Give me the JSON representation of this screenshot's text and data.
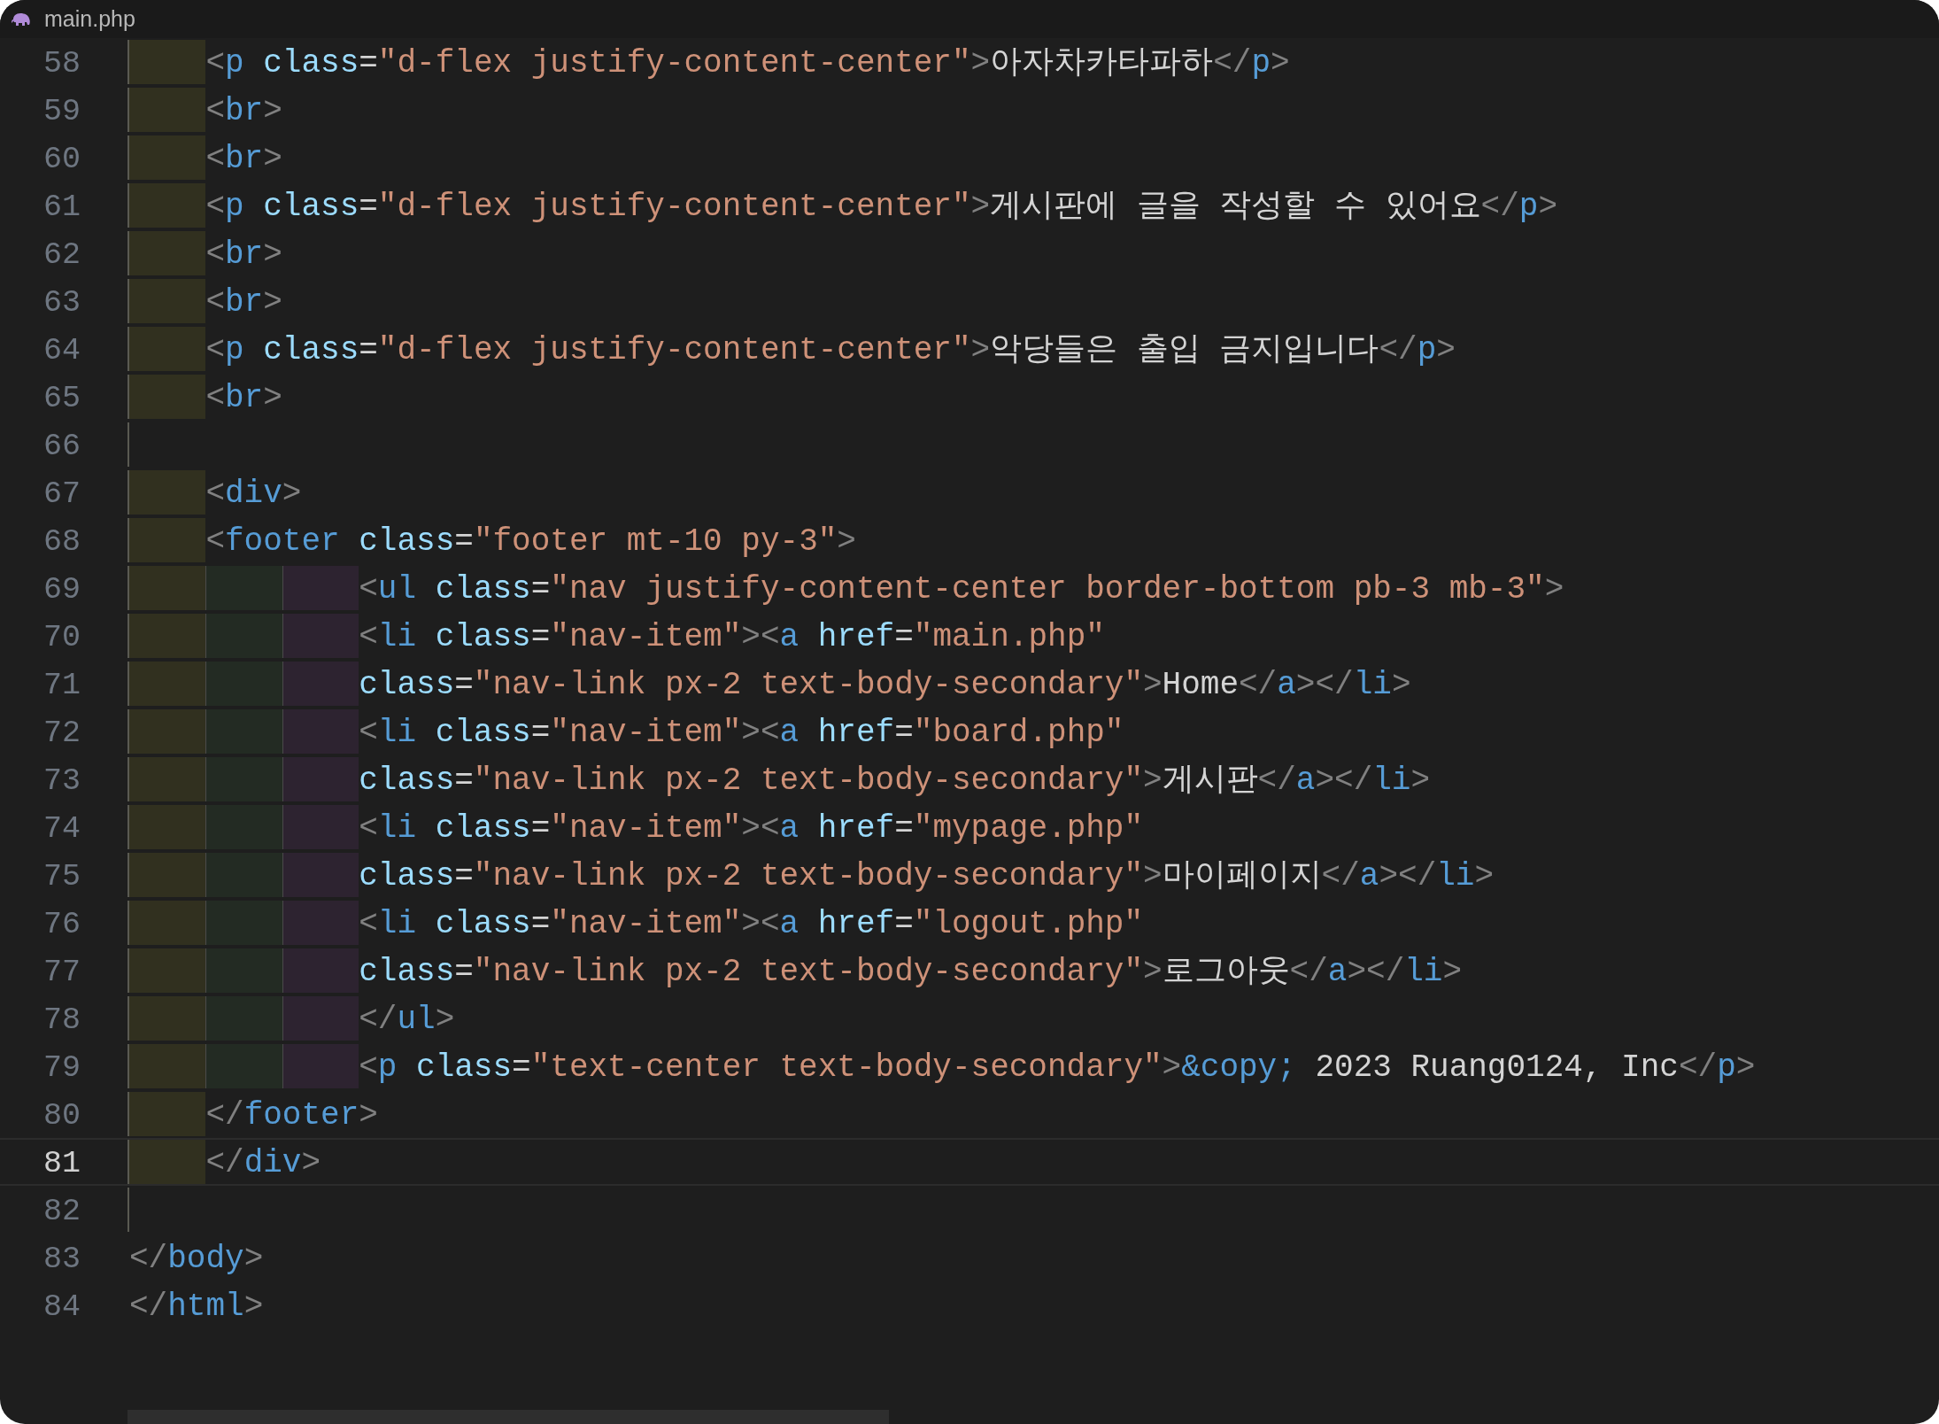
{
  "tab": {
    "title": "main.php"
  },
  "lines": [
    {
      "number": "58",
      "selected": false,
      "rule": true,
      "guides": [
        {
          "color": "#31301f"
        }
      ],
      "tokens": [
        {
          "kind": "punct",
          "text": "<"
        },
        {
          "kind": "tag",
          "text": "p"
        },
        {
          "kind": "attr",
          "text": " class"
        },
        {
          "kind": "op",
          "text": "="
        },
        {
          "kind": "string",
          "text": "\"d-flex justify-content-center\""
        },
        {
          "kind": "punct",
          "text": ">"
        },
        {
          "kind": "text",
          "text": "아자차카타파하"
        },
        {
          "kind": "punct",
          "text": "</"
        },
        {
          "kind": "tag",
          "text": "p"
        },
        {
          "kind": "punct",
          "text": ">"
        }
      ]
    },
    {
      "number": "59",
      "selected": false,
      "rule": true,
      "guides": [
        {
          "color": "#31301f"
        }
      ],
      "tokens": [
        {
          "kind": "punct",
          "text": "<"
        },
        {
          "kind": "tag",
          "text": "br"
        },
        {
          "kind": "punct",
          "text": ">"
        }
      ]
    },
    {
      "number": "60",
      "selected": false,
      "rule": true,
      "guides": [
        {
          "color": "#31301f"
        }
      ],
      "tokens": [
        {
          "kind": "punct",
          "text": "<"
        },
        {
          "kind": "tag",
          "text": "br"
        },
        {
          "kind": "punct",
          "text": ">"
        }
      ]
    },
    {
      "number": "61",
      "selected": false,
      "rule": true,
      "guides": [
        {
          "color": "#31301f"
        }
      ],
      "tokens": [
        {
          "kind": "punct",
          "text": "<"
        },
        {
          "kind": "tag",
          "text": "p"
        },
        {
          "kind": "attr",
          "text": " class"
        },
        {
          "kind": "op",
          "text": "="
        },
        {
          "kind": "string",
          "text": "\"d-flex justify-content-center\""
        },
        {
          "kind": "punct",
          "text": ">"
        },
        {
          "kind": "text",
          "text": "게시판에 글을 작성할 수 있어요"
        },
        {
          "kind": "punct",
          "text": "</"
        },
        {
          "kind": "tag",
          "text": "p"
        },
        {
          "kind": "punct",
          "text": ">"
        }
      ]
    },
    {
      "number": "62",
      "selected": false,
      "rule": true,
      "guides": [
        {
          "color": "#31301f"
        }
      ],
      "tokens": [
        {
          "kind": "punct",
          "text": "<"
        },
        {
          "kind": "tag",
          "text": "br"
        },
        {
          "kind": "punct",
          "text": ">"
        }
      ]
    },
    {
      "number": "63",
      "selected": false,
      "rule": true,
      "guides": [
        {
          "color": "#31301f"
        }
      ],
      "tokens": [
        {
          "kind": "punct",
          "text": "<"
        },
        {
          "kind": "tag",
          "text": "br"
        },
        {
          "kind": "punct",
          "text": ">"
        }
      ]
    },
    {
      "number": "64",
      "selected": false,
      "rule": true,
      "guides": [
        {
          "color": "#31301f"
        }
      ],
      "tokens": [
        {
          "kind": "punct",
          "text": "<"
        },
        {
          "kind": "tag",
          "text": "p"
        },
        {
          "kind": "attr",
          "text": " class"
        },
        {
          "kind": "op",
          "text": "="
        },
        {
          "kind": "string",
          "text": "\"d-flex justify-content-center\""
        },
        {
          "kind": "punct",
          "text": ">"
        },
        {
          "kind": "text",
          "text": "악당들은 출입 금지입니다"
        },
        {
          "kind": "punct",
          "text": "</"
        },
        {
          "kind": "tag",
          "text": "p"
        },
        {
          "kind": "punct",
          "text": ">"
        }
      ]
    },
    {
      "number": "65",
      "selected": false,
      "rule": true,
      "guides": [
        {
          "color": "#31301f"
        }
      ],
      "tokens": [
        {
          "kind": "punct",
          "text": "<"
        },
        {
          "kind": "tag",
          "text": "br"
        },
        {
          "kind": "punct",
          "text": ">"
        }
      ]
    },
    {
      "number": "66",
      "selected": false,
      "rule": true
    },
    {
      "number": "67",
      "selected": false,
      "rule": true,
      "guides": [
        {
          "color": "#31301f"
        }
      ],
      "tokens": [
        {
          "kind": "punct",
          "text": "<"
        },
        {
          "kind": "tag",
          "text": "div"
        },
        {
          "kind": "punct",
          "text": ">"
        }
      ]
    },
    {
      "number": "68",
      "selected": false,
      "rule": true,
      "guides": [
        {
          "color": "#31301f"
        }
      ],
      "tokens": [
        {
          "kind": "punct",
          "text": "<"
        },
        {
          "kind": "tag",
          "text": "footer"
        },
        {
          "kind": "attr",
          "text": " class"
        },
        {
          "kind": "op",
          "text": "="
        },
        {
          "kind": "string",
          "text": "\"footer mt-10 py-3\""
        },
        {
          "kind": "punct",
          "text": ">"
        }
      ]
    },
    {
      "number": "69",
      "selected": false,
      "rule": true,
      "guides": [
        {
          "color": "#31301f"
        },
        {
          "color": "#232b23"
        },
        {
          "color": "#2d2330"
        }
      ],
      "tokens": [
        {
          "kind": "punct",
          "text": "<"
        },
        {
          "kind": "tag",
          "text": "ul"
        },
        {
          "kind": "attr",
          "text": " class"
        },
        {
          "kind": "op",
          "text": "="
        },
        {
          "kind": "string",
          "text": "\"nav justify-content-center border-bottom pb-3 mb-3\""
        },
        {
          "kind": "punct",
          "text": ">"
        }
      ]
    },
    {
      "number": "70",
      "selected": false,
      "rule": true,
      "guides": [
        {
          "color": "#31301f"
        },
        {
          "color": "#232b23"
        },
        {
          "color": "#2d2330"
        }
      ],
      "tokens": [
        {
          "kind": "punct",
          "text": "<"
        },
        {
          "kind": "tag",
          "text": "li"
        },
        {
          "kind": "attr",
          "text": " class"
        },
        {
          "kind": "op",
          "text": "="
        },
        {
          "kind": "string",
          "text": "\"nav-item\""
        },
        {
          "kind": "punct",
          "text": "><"
        },
        {
          "kind": "tag",
          "text": "a"
        },
        {
          "kind": "attr",
          "text": " href"
        },
        {
          "kind": "op",
          "text": "="
        },
        {
          "kind": "string",
          "text": "\"main.php\""
        }
      ]
    },
    {
      "number": "71",
      "selected": false,
      "rule": true,
      "guides": [
        {
          "color": "#31301f"
        },
        {
          "color": "#232b23"
        },
        {
          "color": "#2d2330"
        }
      ],
      "tokens": [
        {
          "kind": "attr",
          "text": "class"
        },
        {
          "kind": "op",
          "text": "="
        },
        {
          "kind": "string",
          "text": "\"nav-link px-2 text-body-secondary\""
        },
        {
          "kind": "punct",
          "text": ">"
        },
        {
          "kind": "text",
          "text": "Home"
        },
        {
          "kind": "punct",
          "text": "</"
        },
        {
          "kind": "tag",
          "text": "a"
        },
        {
          "kind": "punct",
          "text": "></"
        },
        {
          "kind": "tag",
          "text": "li"
        },
        {
          "kind": "punct",
          "text": ">"
        }
      ]
    },
    {
      "number": "72",
      "selected": false,
      "rule": true,
      "guides": [
        {
          "color": "#31301f"
        },
        {
          "color": "#232b23"
        },
        {
          "color": "#2d2330"
        }
      ],
      "tokens": [
        {
          "kind": "punct",
          "text": "<"
        },
        {
          "kind": "tag",
          "text": "li"
        },
        {
          "kind": "attr",
          "text": " class"
        },
        {
          "kind": "op",
          "text": "="
        },
        {
          "kind": "string",
          "text": "\"nav-item\""
        },
        {
          "kind": "punct",
          "text": "><"
        },
        {
          "kind": "tag",
          "text": "a"
        },
        {
          "kind": "attr",
          "text": " href"
        },
        {
          "kind": "op",
          "text": "="
        },
        {
          "kind": "string",
          "text": "\"board.php\""
        }
      ]
    },
    {
      "number": "73",
      "selected": false,
      "rule": true,
      "guides": [
        {
          "color": "#31301f"
        },
        {
          "color": "#232b23"
        },
        {
          "color": "#2d2330"
        }
      ],
      "tokens": [
        {
          "kind": "attr",
          "text": "class"
        },
        {
          "kind": "op",
          "text": "="
        },
        {
          "kind": "string",
          "text": "\"nav-link px-2 text-body-secondary\""
        },
        {
          "kind": "punct",
          "text": ">"
        },
        {
          "kind": "text",
          "text": "게시판"
        },
        {
          "kind": "punct",
          "text": "</"
        },
        {
          "kind": "tag",
          "text": "a"
        },
        {
          "kind": "punct",
          "text": "></"
        },
        {
          "kind": "tag",
          "text": "li"
        },
        {
          "kind": "punct",
          "text": ">"
        }
      ]
    },
    {
      "number": "74",
      "selected": false,
      "rule": true,
      "guides": [
        {
          "color": "#31301f"
        },
        {
          "color": "#232b23"
        },
        {
          "color": "#2d2330"
        }
      ],
      "tokens": [
        {
          "kind": "punct",
          "text": "<"
        },
        {
          "kind": "tag",
          "text": "li"
        },
        {
          "kind": "attr",
          "text": " class"
        },
        {
          "kind": "op",
          "text": "="
        },
        {
          "kind": "string",
          "text": "\"nav-item\""
        },
        {
          "kind": "punct",
          "text": "><"
        },
        {
          "kind": "tag",
          "text": "a"
        },
        {
          "kind": "attr",
          "text": " href"
        },
        {
          "kind": "op",
          "text": "="
        },
        {
          "kind": "string",
          "text": "\"mypage.php\""
        }
      ]
    },
    {
      "number": "75",
      "selected": false,
      "rule": true,
      "guides": [
        {
          "color": "#31301f"
        },
        {
          "color": "#232b23"
        },
        {
          "color": "#2d2330"
        }
      ],
      "tokens": [
        {
          "kind": "attr",
          "text": "class"
        },
        {
          "kind": "op",
          "text": "="
        },
        {
          "kind": "string",
          "text": "\"nav-link px-2 text-body-secondary\""
        },
        {
          "kind": "punct",
          "text": ">"
        },
        {
          "kind": "text",
          "text": "마이페이지"
        },
        {
          "kind": "punct",
          "text": "</"
        },
        {
          "kind": "tag",
          "text": "a"
        },
        {
          "kind": "punct",
          "text": "></"
        },
        {
          "kind": "tag",
          "text": "li"
        },
        {
          "kind": "punct",
          "text": ">"
        }
      ]
    },
    {
      "number": "76",
      "selected": false,
      "rule": true,
      "guides": [
        {
          "color": "#31301f"
        },
        {
          "color": "#232b23"
        },
        {
          "color": "#2d2330"
        }
      ],
      "tokens": [
        {
          "kind": "punct",
          "text": "<"
        },
        {
          "kind": "tag",
          "text": "li"
        },
        {
          "kind": "attr",
          "text": " class"
        },
        {
          "kind": "op",
          "text": "="
        },
        {
          "kind": "string",
          "text": "\"nav-item\""
        },
        {
          "kind": "punct",
          "text": "><"
        },
        {
          "kind": "tag",
          "text": "a"
        },
        {
          "kind": "attr",
          "text": " href"
        },
        {
          "kind": "op",
          "text": "="
        },
        {
          "kind": "string",
          "text": "\"logout.php\""
        }
      ]
    },
    {
      "number": "77",
      "selected": false,
      "rule": true,
      "guides": [
        {
          "color": "#31301f"
        },
        {
          "color": "#232b23"
        },
        {
          "color": "#2d2330"
        }
      ],
      "tokens": [
        {
          "kind": "attr",
          "text": "class"
        },
        {
          "kind": "op",
          "text": "="
        },
        {
          "kind": "string",
          "text": "\"nav-link px-2 text-body-secondary\""
        },
        {
          "kind": "punct",
          "text": ">"
        },
        {
          "kind": "text",
          "text": "로그아웃"
        },
        {
          "kind": "punct",
          "text": "</"
        },
        {
          "kind": "tag",
          "text": "a"
        },
        {
          "kind": "punct",
          "text": "></"
        },
        {
          "kind": "tag",
          "text": "li"
        },
        {
          "kind": "punct",
          "text": ">"
        }
      ]
    },
    {
      "number": "78",
      "selected": false,
      "rule": true,
      "guides": [
        {
          "color": "#31301f"
        },
        {
          "color": "#232b23"
        },
        {
          "color": "#2d2330"
        }
      ],
      "tokens": [
        {
          "kind": "punct",
          "text": "</"
        },
        {
          "kind": "tag",
          "text": "ul"
        },
        {
          "kind": "punct",
          "text": ">"
        }
      ]
    },
    {
      "number": "79",
      "selected": false,
      "rule": true,
      "guides": [
        {
          "color": "#31301f"
        },
        {
          "color": "#232b23"
        },
        {
          "color": "#2d2330"
        }
      ],
      "tokens": [
        {
          "kind": "punct",
          "text": "<"
        },
        {
          "kind": "tag",
          "text": "p"
        },
        {
          "kind": "attr",
          "text": " class"
        },
        {
          "kind": "op",
          "text": "="
        },
        {
          "kind": "string",
          "text": "\"text-center text-body-secondary\""
        },
        {
          "kind": "punct",
          "text": ">"
        },
        {
          "kind": "entity",
          "text": "&copy;"
        },
        {
          "kind": "text",
          "text": " 2023 Ruang0124, Inc"
        },
        {
          "kind": "punct",
          "text": "</"
        },
        {
          "kind": "tag",
          "text": "p"
        },
        {
          "kind": "punct",
          "text": ">"
        }
      ]
    },
    {
      "number": "80",
      "selected": false,
      "rule": true,
      "guides": [
        {
          "color": "#31301f"
        }
      ],
      "tokens": [
        {
          "kind": "punct",
          "text": "</"
        },
        {
          "kind": "tag",
          "text": "footer"
        },
        {
          "kind": "punct",
          "text": ">"
        }
      ]
    },
    {
      "number": "81",
      "selected": true,
      "rule": true,
      "guides": [
        {
          "color": "#31301f"
        }
      ],
      "tokens": [
        {
          "kind": "punct",
          "text": "</"
        },
        {
          "kind": "tag",
          "text": "div"
        },
        {
          "kind": "punct",
          "text": ">"
        }
      ]
    },
    {
      "number": "82",
      "selected": false,
      "rule": true
    },
    {
      "number": "83",
      "selected": false,
      "rule": false,
      "tokens": [
        {
          "kind": "punct",
          "text": "</"
        },
        {
          "kind": "tag",
          "text": "body"
        },
        {
          "kind": "punct",
          "text": ">"
        }
      ]
    },
    {
      "number": "84",
      "selected": false,
      "rule": false,
      "tokens": [
        {
          "kind": "punct",
          "text": "</"
        },
        {
          "kind": "tag",
          "text": "html"
        },
        {
          "kind": "punct",
          "text": ">"
        }
      ]
    }
  ]
}
